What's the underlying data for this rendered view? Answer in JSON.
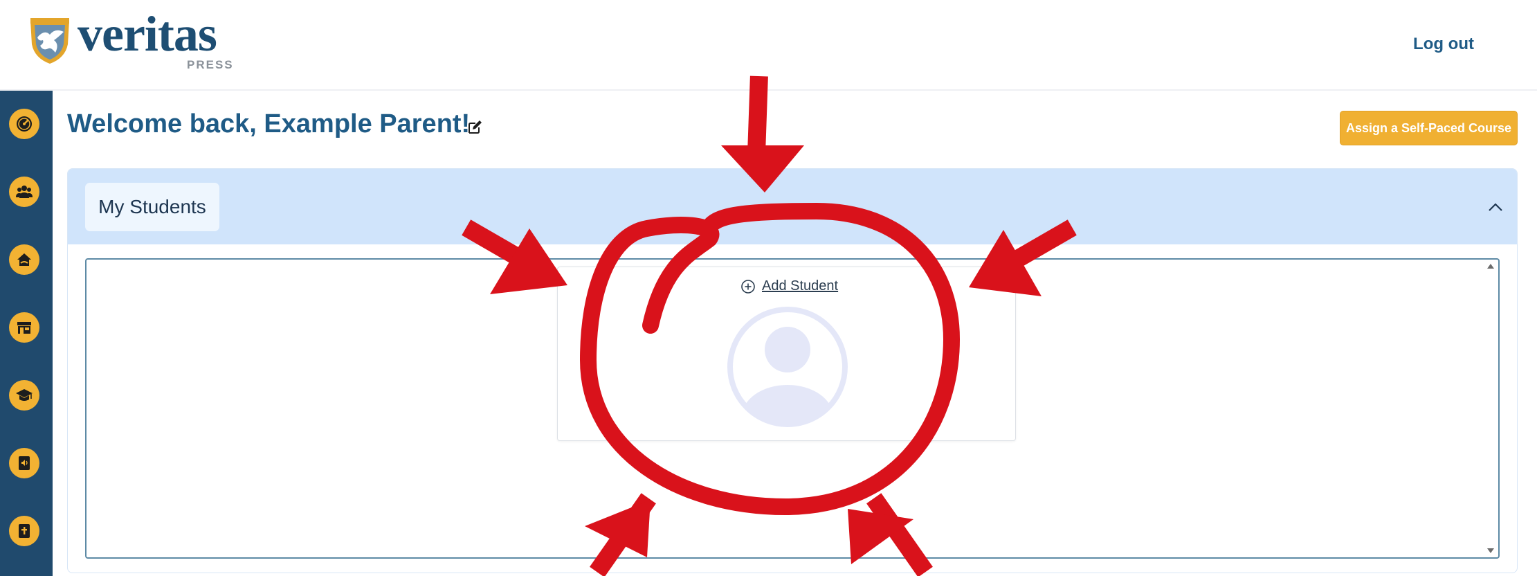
{
  "header": {
    "logo_text": "veritas",
    "logo_sub": "PRESS",
    "logout_label": "Log out"
  },
  "sidebar": {
    "items": [
      {
        "icon": "dashboard-gauge-icon"
      },
      {
        "icon": "users-group-icon"
      },
      {
        "icon": "home-school-icon"
      },
      {
        "icon": "store-icon"
      },
      {
        "icon": "graduation-cap-icon"
      },
      {
        "icon": "audio-book-icon"
      },
      {
        "icon": "bible-book-icon"
      }
    ]
  },
  "main": {
    "welcome": "Welcome back, Example Parent!",
    "assign_button": "Assign a Self-Paced Course",
    "panel": {
      "tab_label": "My Students",
      "add_student_label": "Add Student"
    }
  },
  "colors": {
    "brand_navy": "#204a6d",
    "title_blue": "#1f5b86",
    "accent_gold": "#f0b032",
    "panel_header": "#d0e4fb",
    "annotation_red": "#d9121b"
  }
}
